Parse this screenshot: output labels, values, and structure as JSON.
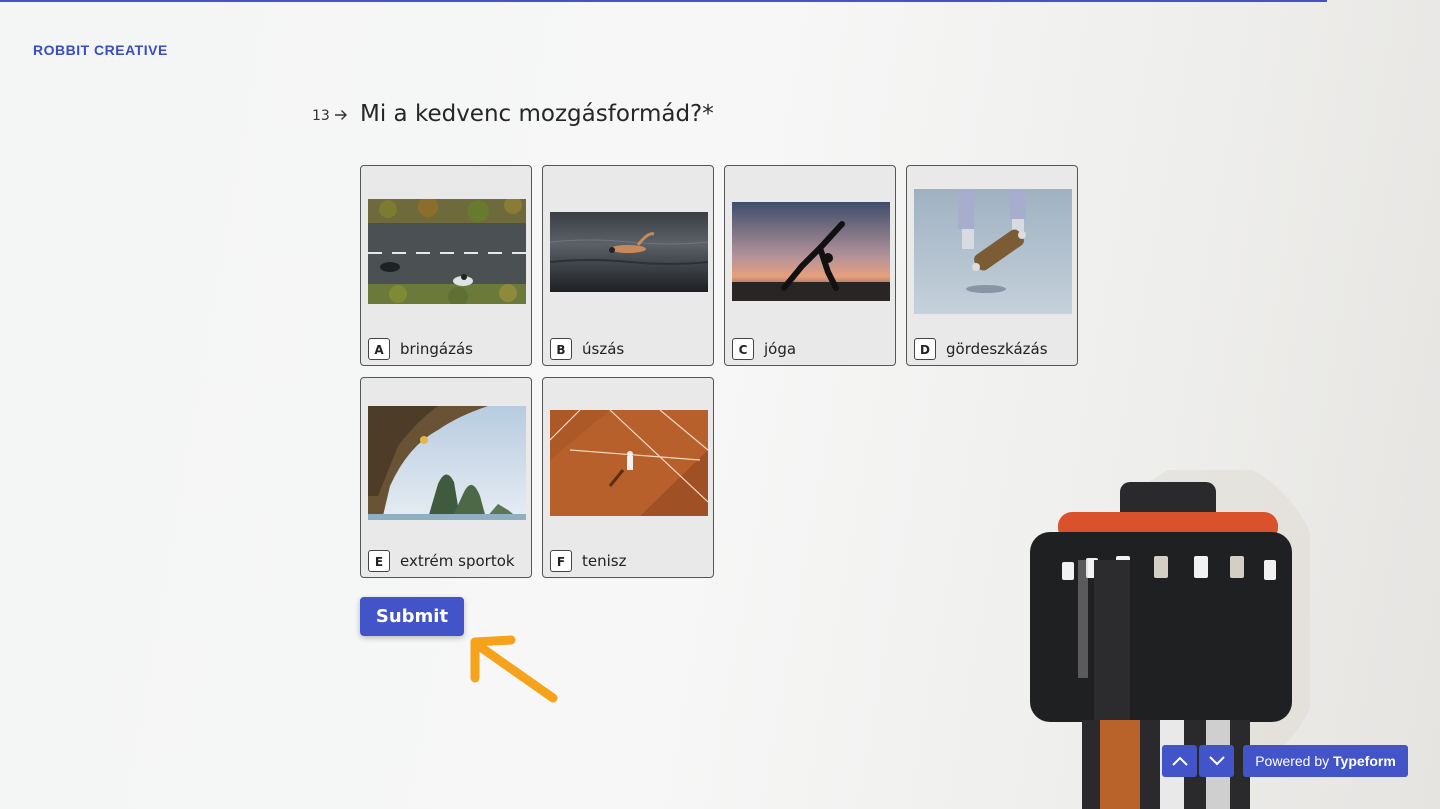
{
  "brand": {
    "logo": "ROBBIT CREATIVE"
  },
  "question": {
    "number": "13",
    "arrow_icon": "arrow-right-icon",
    "title": "Mi a kedvenc mozgásformád?*"
  },
  "choices": [
    {
      "key": "A",
      "label": "bringázás"
    },
    {
      "key": "B",
      "label": "úszás"
    },
    {
      "key": "C",
      "label": "jóga"
    },
    {
      "key": "D",
      "label": "gördeszkázás"
    },
    {
      "key": "E",
      "label": "extrém sportok"
    },
    {
      "key": "F",
      "label": "tenisz"
    }
  ],
  "submit": {
    "label": "Submit"
  },
  "footer": {
    "nav_up_icon": "chevron-up-icon",
    "nav_down_icon": "chevron-down-icon",
    "powered_prefix": "Powered by",
    "powered_brand": "Typeform"
  },
  "colors": {
    "accent": "#4353c8",
    "annotation_arrow": "#f7a21b"
  }
}
